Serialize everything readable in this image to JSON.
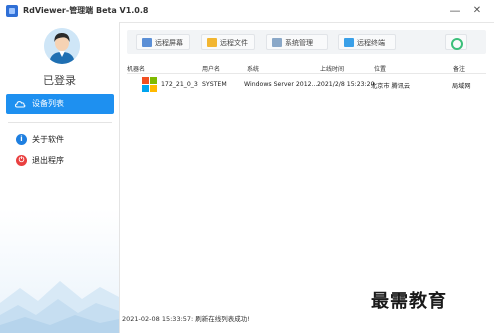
{
  "window": {
    "title": "RdViewer-管理端 Beta V1.0.8",
    "minimize_glyph": "—",
    "close_glyph": "✕"
  },
  "sidebar": {
    "login_status": "已登录",
    "items": [
      {
        "label": "设备列表",
        "icon": "cloud-icon",
        "active": true
      },
      {
        "label": "关于软件",
        "icon": "info-icon",
        "icon_glyph": "i"
      },
      {
        "label": "退出程序",
        "icon": "power-icon",
        "icon_glyph": "⏻"
      }
    ]
  },
  "toolbar": {
    "buttons": [
      {
        "label": "远程屏幕",
        "icon": "monitor-icon"
      },
      {
        "label": "远程文件",
        "icon": "folder-icon"
      },
      {
        "label": "系统管理",
        "icon": "settings-panel-icon"
      },
      {
        "label": "远程终端",
        "icon": "terminal-icon"
      }
    ],
    "refresh_icon": "refresh-icon"
  },
  "table": {
    "columns": [
      "机器名",
      "用户名",
      "系统",
      "上线时间",
      "位置",
      "备注"
    ],
    "rows": [
      {
        "machine": "172_21_0_3",
        "user": "SYSTEM",
        "os": "Windows Server 2012...",
        "online_time": "2021/2/8 15:23:20",
        "location": "北京市 腾讯云",
        "note": "局域网",
        "icon": "windows-logo-icon"
      }
    ]
  },
  "status": {
    "message": "2021-02-08 15:33:57:  刷新在线列表成功!"
  },
  "watermark": "最需教育",
  "colors": {
    "accent": "#1e90f0",
    "exit": "#e94040",
    "info": "#1e7fe0"
  }
}
